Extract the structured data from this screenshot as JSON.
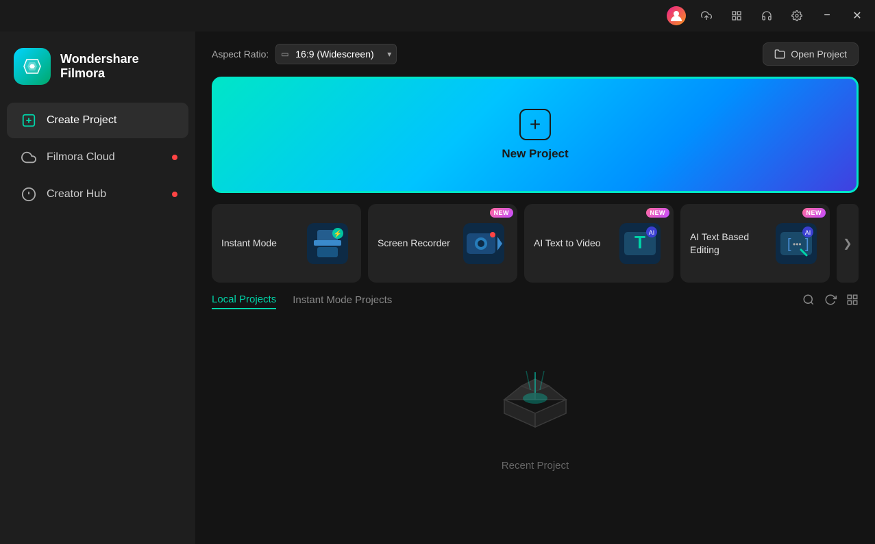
{
  "titlebar": {
    "minimize_label": "−",
    "close_label": "✕"
  },
  "sidebar": {
    "logo": {
      "line1": "Wondershare",
      "line2": "Filmora"
    },
    "nav": [
      {
        "id": "create-project",
        "label": "Create Project",
        "icon": "➕",
        "active": true,
        "badge": false
      },
      {
        "id": "filmora-cloud",
        "label": "Filmora Cloud",
        "icon": "☁",
        "active": false,
        "badge": true
      },
      {
        "id": "creator-hub",
        "label": "Creator Hub",
        "icon": "💡",
        "active": false,
        "badge": true
      }
    ]
  },
  "header": {
    "aspect_ratio_label": "Aspect Ratio:",
    "aspect_ratio_value": "16:9 (Widescreen)",
    "open_project_label": "Open Project"
  },
  "new_project": {
    "label": "New Project"
  },
  "feature_cards": [
    {
      "id": "instant-mode",
      "label": "Instant Mode",
      "has_badge": false,
      "icon_emoji": "📦"
    },
    {
      "id": "screen-recorder",
      "label": "Screen Recorder",
      "has_badge": true,
      "icon_emoji": "🎥"
    },
    {
      "id": "ai-text-to-video",
      "label": "AI Text to Video",
      "has_badge": true,
      "icon_emoji": "🅃"
    },
    {
      "id": "ai-text-based-editing",
      "label": "AI Text Based Editing",
      "has_badge": true,
      "icon_emoji": "✎"
    }
  ],
  "cards_next": "❯",
  "projects": {
    "tabs": [
      {
        "id": "local",
        "label": "Local Projects",
        "active": true
      },
      {
        "id": "instant",
        "label": "Instant Mode Projects",
        "active": false
      }
    ],
    "actions": {
      "search": "🔍",
      "refresh": "↺",
      "grid": "⊞"
    },
    "empty_label": "Recent Project"
  },
  "badge_label": "NEW"
}
